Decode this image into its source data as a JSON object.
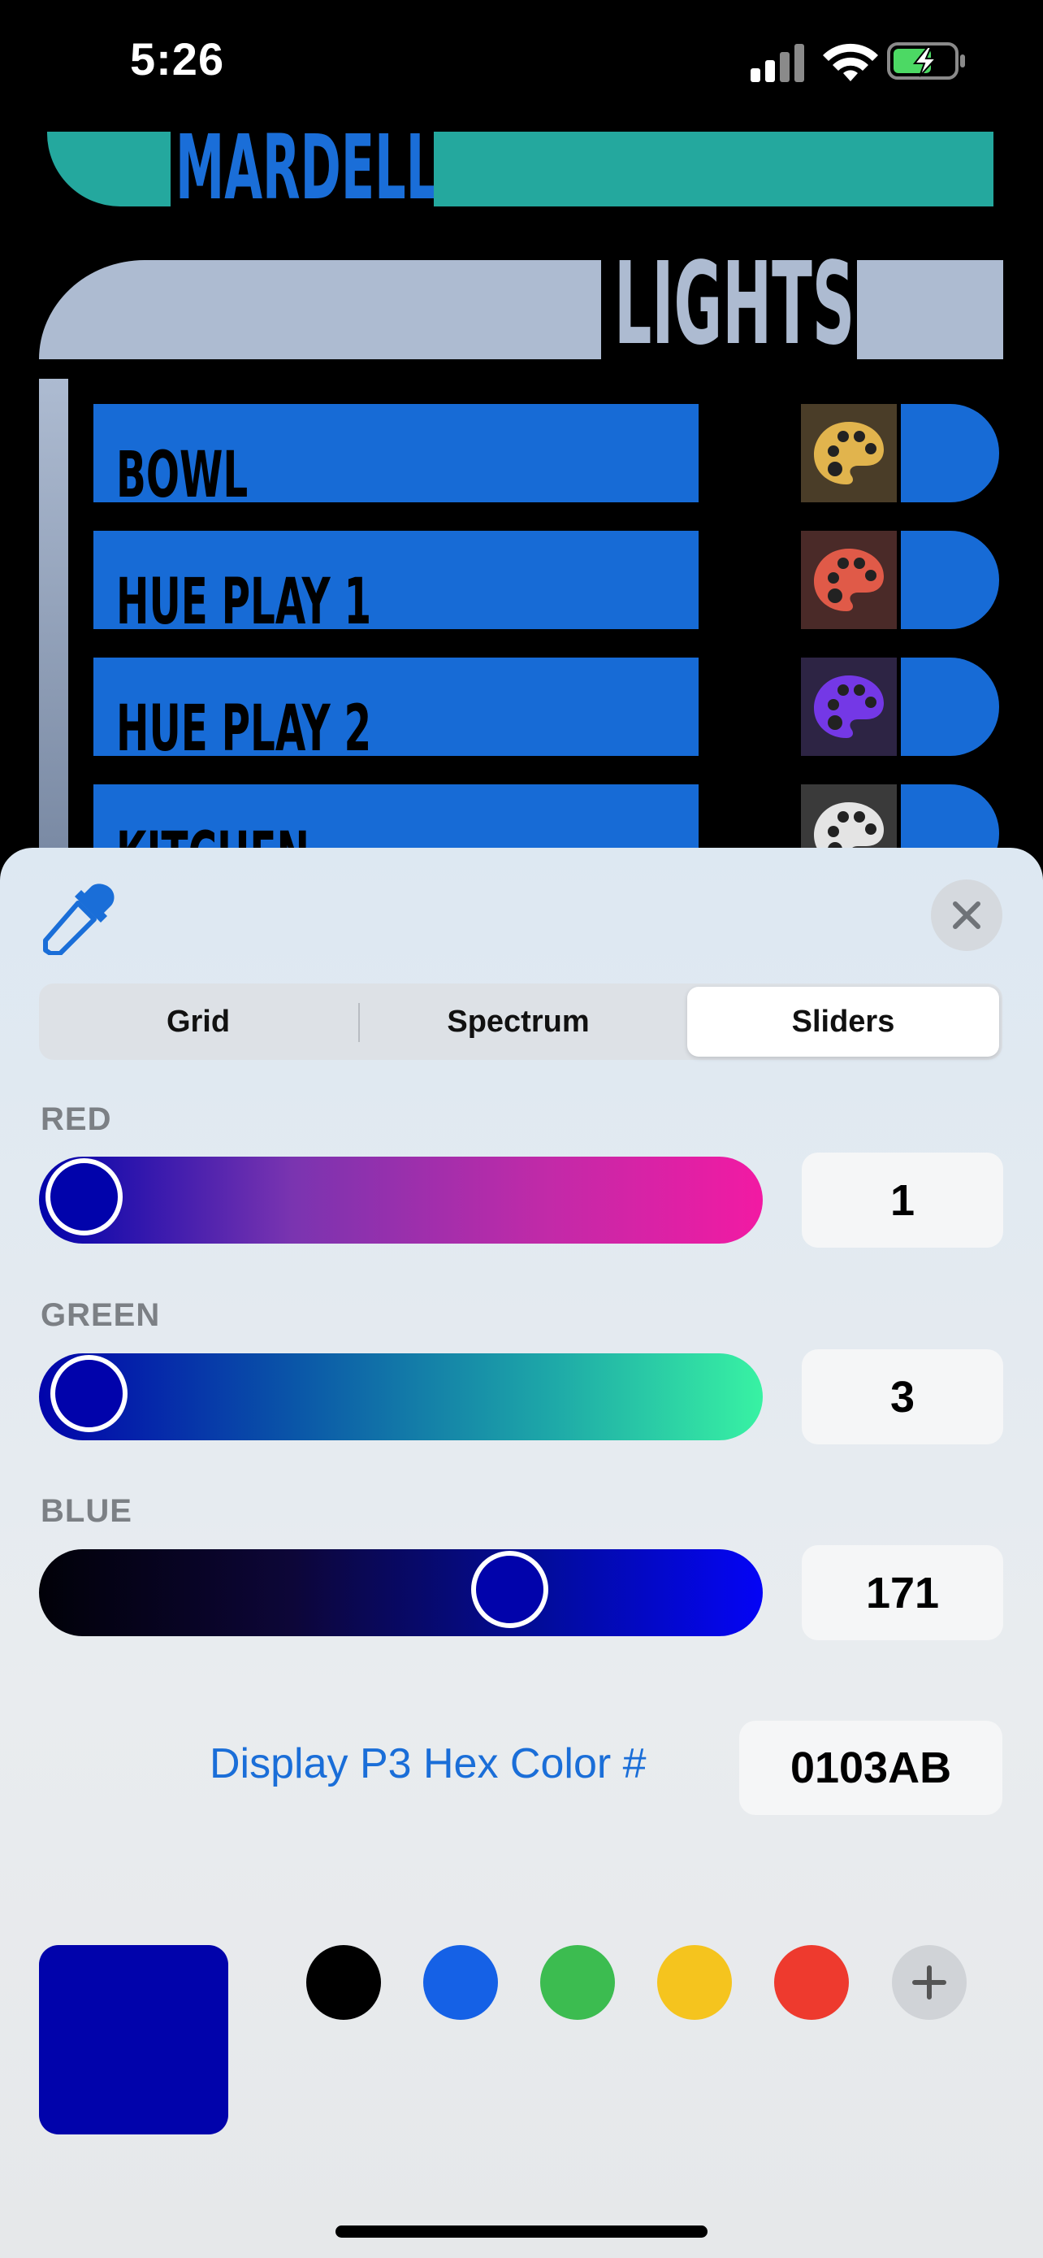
{
  "status_bar": {
    "time": "5:26"
  },
  "header": {
    "app_name": "MARDELL",
    "section_title": "LIGHTS"
  },
  "lights": [
    {
      "name": "BOWL",
      "palette_color": "#e1b44d",
      "palette_bg": "#4a3d28"
    },
    {
      "name": "HUE PLAY 1",
      "palette_color": "#e05a48",
      "palette_bg": "#4a2a28"
    },
    {
      "name": "HUE PLAY 2",
      "palette_color": "#7438e6",
      "palette_bg": "#2d2444"
    },
    {
      "name": "KITCHEN",
      "palette_color": "#e4e4e4",
      "palette_bg": "#3a3a3a"
    }
  ],
  "colors": {
    "lcars_teal": "#24a89e",
    "lcars_gray": "#adbbd1",
    "lcars_blue": "#176bd6",
    "current": "#0103ab"
  },
  "picker": {
    "eyedropper_icon": "eyedropper-icon",
    "close_icon": "close-icon",
    "tabs": [
      {
        "label": "Grid",
        "active": false
      },
      {
        "label": "Spectrum",
        "active": false
      },
      {
        "label": "Sliders",
        "active": true
      }
    ],
    "channels": [
      {
        "label": "RED",
        "value": "1",
        "level": 1
      },
      {
        "label": "GREEN",
        "value": "3",
        "level": 3
      },
      {
        "label": "BLUE",
        "value": "171",
        "level": 171
      }
    ],
    "hex_label": "Display P3 Hex Color #",
    "hex_value": "0103AB",
    "swatches": [
      "#000000",
      "#1561e6",
      "#3cbc50",
      "#f5c41e",
      "#ee3a2e"
    ],
    "add_icon": "plus-icon"
  }
}
